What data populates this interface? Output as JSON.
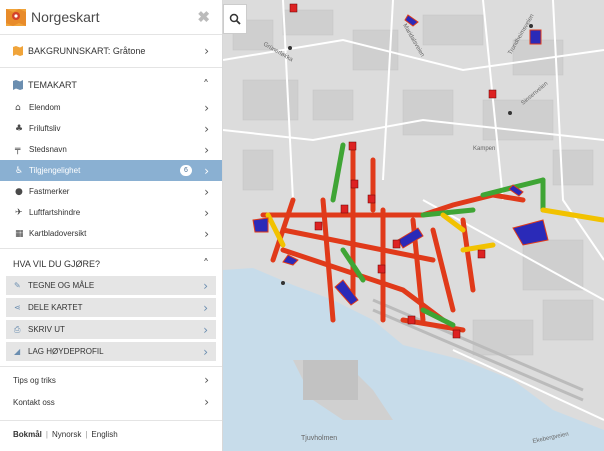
{
  "app": {
    "title": "Norgeskart",
    "close_symbol": "✖"
  },
  "background_map": {
    "label": "BAKGRUNNSKART: Gråtone"
  },
  "theme_maps": {
    "heading": "TEMAKART",
    "items": [
      {
        "label": "Elendom",
        "icon": "house-icon"
      },
      {
        "label": "Friluftsliv",
        "icon": "tree-icon"
      },
      {
        "label": "Stedsnavn",
        "icon": "signpost-icon"
      },
      {
        "label": "Tilgjengelighet",
        "icon": "wheelchair-icon",
        "badge": "6",
        "active": true
      },
      {
        "label": "Fastmerker",
        "icon": "pin-icon"
      },
      {
        "label": "Luftfartshindre",
        "icon": "airplane-icon"
      },
      {
        "label": "Kartbladoversikt",
        "icon": "map-icon"
      }
    ]
  },
  "actions": {
    "heading": "HVA VIL DU GJØRE?",
    "items": [
      {
        "label": "TEGNE OG MÅLE",
        "icon": "pencil-icon"
      },
      {
        "label": "DELE KARTET",
        "icon": "share-icon"
      },
      {
        "label": "SKRIV UT",
        "icon": "printer-icon"
      },
      {
        "label": "LAG HØYDEPROFIL",
        "icon": "chart-icon"
      }
    ]
  },
  "links": {
    "tips": "Tips og triks",
    "contact": "Kontakt oss"
  },
  "languages": [
    "Bokmål",
    "Nynorsk",
    "English"
  ],
  "map": {
    "place_label": "Tjuvholmen",
    "street_labels": [
      "Grünerløkka",
      "Maridalsveien",
      "Trondheimsveien",
      "Kampen",
      "Sinsenveien",
      "Ekebergveien"
    ],
    "colors": {
      "good": "#3fa535",
      "medium": "#f2c200",
      "poor": "#e03a1a",
      "water": "#c7dcea",
      "parking": "#2a2ab8"
    }
  }
}
